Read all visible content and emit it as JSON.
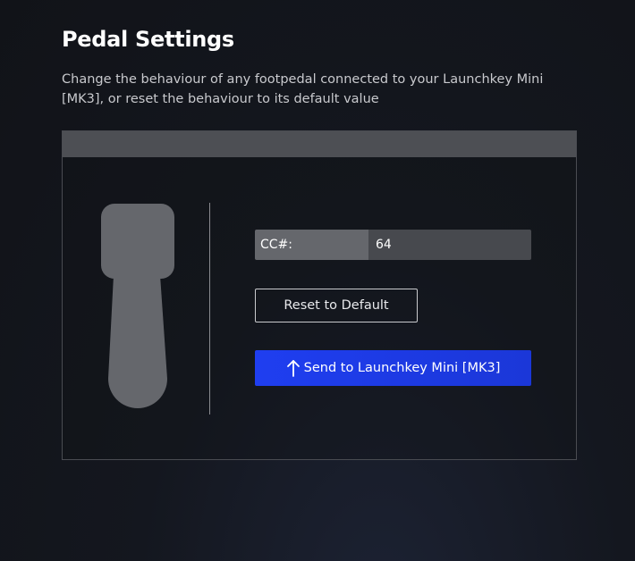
{
  "page": {
    "title": "Pedal Settings",
    "description": "Change the behaviour of any footpedal connected to your Launchkey Mini [MK3], or reset the behaviour to its default value"
  },
  "panel": {
    "pedal_icon": "sustain-pedal-icon",
    "cc": {
      "label": "CC#:",
      "value": "64"
    },
    "reset_label": "Reset to Default",
    "send": {
      "icon": "arrow-up-icon",
      "label": "Send to Launchkey Mini [MK3]"
    }
  },
  "colors": {
    "background": "#111318",
    "panel_header": "#4d4f54",
    "cc_label_bg": "#65676c",
    "cc_input_bg": "#47494e",
    "accent": "#1f3ef0",
    "pedal": "#65676c"
  }
}
